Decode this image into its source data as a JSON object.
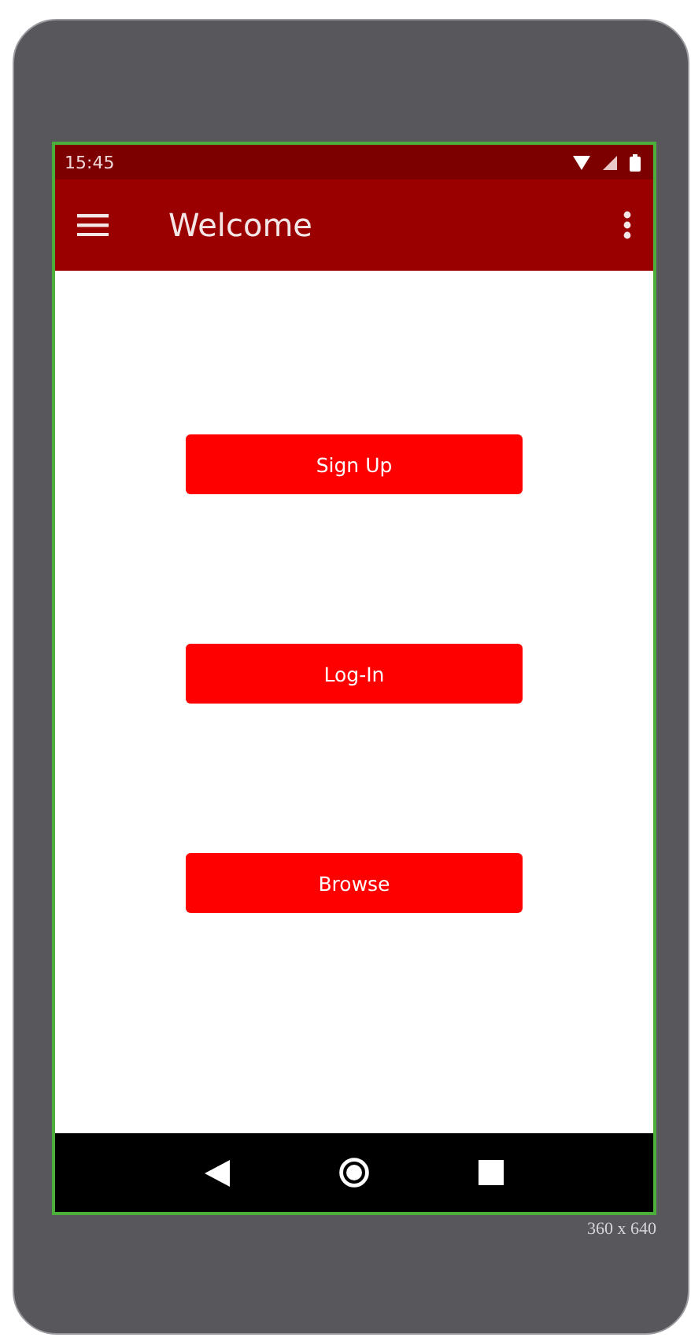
{
  "status_bar": {
    "time": "15:45"
  },
  "app_bar": {
    "title": "Welcome"
  },
  "buttons": [
    {
      "label": "Sign Up"
    },
    {
      "label": "Log-In"
    },
    {
      "label": "Browse"
    }
  ],
  "screen_size": "360 x 640"
}
